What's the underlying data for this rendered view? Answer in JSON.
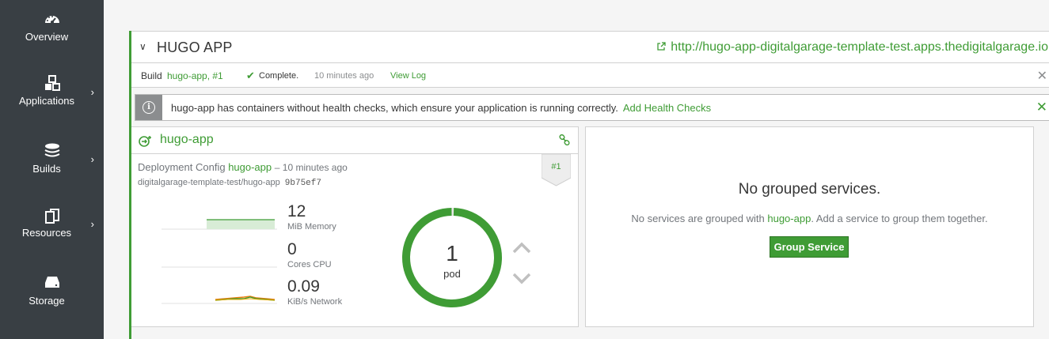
{
  "sidebar": {
    "items": [
      {
        "label": "Overview",
        "icon": "dashboard-icon",
        "has_chevron": false
      },
      {
        "label": "Applications",
        "icon": "cubes-icon",
        "has_chevron": true
      },
      {
        "label": "Builds",
        "icon": "layers-icon",
        "has_chevron": true
      },
      {
        "label": "Resources",
        "icon": "files-icon",
        "has_chevron": true
      },
      {
        "label": "Storage",
        "icon": "hdd-icon",
        "has_chevron": false
      }
    ],
    "chevron": "›"
  },
  "app": {
    "toggle": "∨",
    "title": "HUGO APP",
    "route_url": "http://hugo-app-digitalgarage-template-test.apps.thedigitalgarage.io",
    "route_icon": "external-link-icon"
  },
  "build": {
    "prefix": "Build",
    "name_link": "hugo-app, #1",
    "status_icon": "✔",
    "status": "Complete.",
    "time": "10 minutes ago",
    "view_log": "View Log",
    "close": "✕"
  },
  "alert": {
    "icon": "i",
    "text": "hugo-app has containers without health checks, which ensure your application is running correctly.",
    "link": "Add Health Checks",
    "close": "✕"
  },
  "deployment": {
    "service_name": "hugo-app",
    "config_prefix": "Deployment Config",
    "config_name": "hugo-app",
    "config_time": "– 10 minutes ago",
    "image": "digitalgarage-template-test/hugo-app",
    "image_hash": "9b75ef7",
    "badge": "#1",
    "metrics": [
      {
        "value": "12",
        "label": "MiB Memory"
      },
      {
        "value": "0",
        "label": "Cores CPU"
      },
      {
        "value": "0.09",
        "label": "KiB/s Network"
      }
    ],
    "pods": {
      "count": "1",
      "label": "pod",
      "fill": 1.0
    },
    "colors": {
      "accent": "#3f9c35",
      "donut": "#3f9c35",
      "network_rx": "#ec7a08",
      "network_tx": "#3f9c35"
    }
  },
  "grouped": {
    "title": "No grouped services.",
    "desc_before": "No services are grouped with",
    "desc_link": "hugo-app",
    "desc_after": ". Add a service to group them together.",
    "button": "Group Service"
  }
}
